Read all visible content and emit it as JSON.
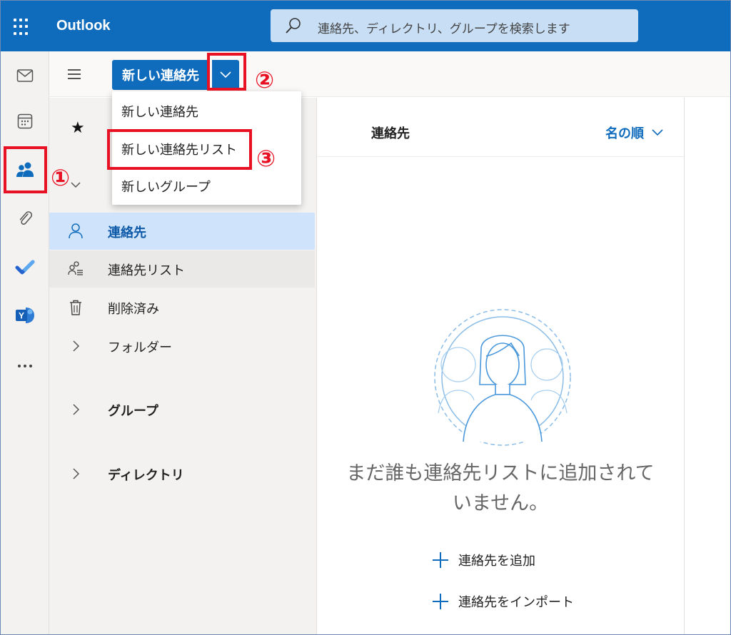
{
  "app": {
    "title": "Outlook"
  },
  "search": {
    "placeholder": "連絡先、ディレクトリ、グループを検索します"
  },
  "rail": {
    "items": [
      "mail-icon",
      "calendar-icon",
      "people-icon",
      "attachment-icon",
      "todo-icon",
      "yammer-icon",
      "more-icon"
    ]
  },
  "toolbar": {
    "new_contact_label": "新しい連絡先"
  },
  "new_menu": {
    "items": [
      "新しい連絡先",
      "新しい連絡先リスト",
      "新しいグループ"
    ]
  },
  "folders": {
    "contacts": "連絡先",
    "contact_lists": "連絡先リスト",
    "deleted": "削除済み",
    "folders": "フォルダー",
    "groups": "グループ",
    "directory": "ディレクトリ"
  },
  "list": {
    "title": "連絡先",
    "sort_label": "名の順",
    "empty_line1": "まだ誰も連絡先リストに追加されて",
    "empty_line2": "いません。",
    "add_contact": "連絡先を追加",
    "import_contacts": "連絡先をインポート"
  },
  "annotations": {
    "one": "①",
    "two": "②",
    "three": "③"
  },
  "colors": {
    "accent": "#0f6cbd",
    "highlight": "#e81123",
    "selected_bg": "#cfe4fa"
  }
}
